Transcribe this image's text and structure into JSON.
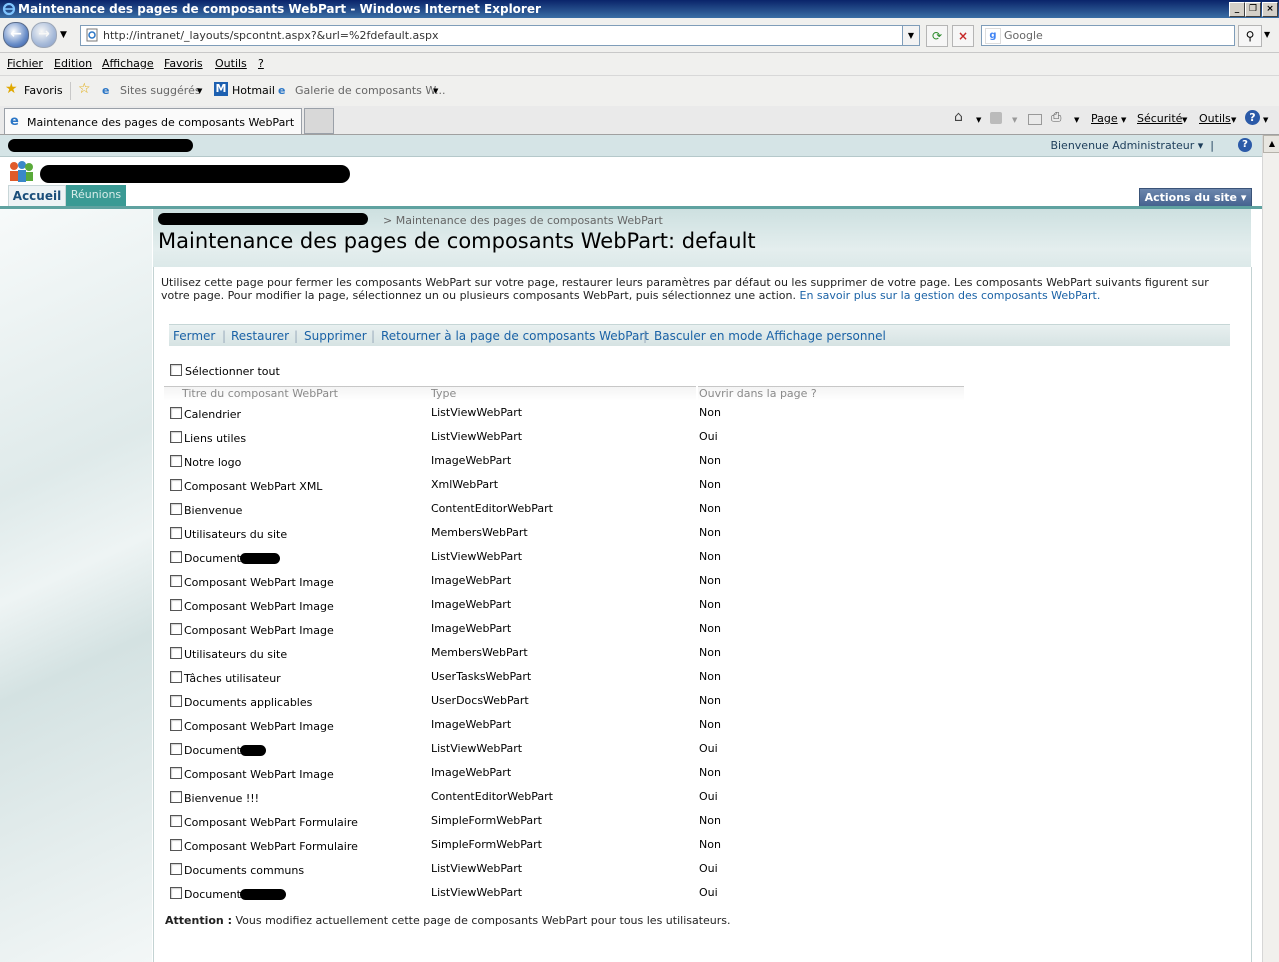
{
  "window": {
    "title": "Maintenance des pages de composants WebPart - Windows Internet Explorer"
  },
  "address": {
    "url": "http://intranet/_layouts/spcontnt.aspx?&url=%2fdefault.aspx",
    "search_placeholder": "Google"
  },
  "menu": [
    "Fichier",
    "Edition",
    "Affichage",
    "Favoris",
    "Outils",
    "?"
  ],
  "favorites": {
    "label": "Favoris",
    "items": [
      "Sites suggérés",
      "Hotmail",
      "Galerie de composants W..."
    ]
  },
  "tab": {
    "title": "Maintenance des pages de composants WebPart"
  },
  "commandbar": {
    "page": "Page",
    "security": "Sécurité",
    "tools": "Outils"
  },
  "sp": {
    "welcome": "Bienvenue Administrateur",
    "nav": {
      "home": "Accueil",
      "meetings": "Réunions"
    },
    "site_actions": "Actions du site",
    "breadcrumb_tail": "> Maintenance des pages de composants WebPart",
    "page_title": "Maintenance des pages de composants WebPart: default",
    "description": "Utilisez cette page pour fermer les composants WebPart sur votre page, restaurer leurs paramètres par défaut ou les supprimer de votre page. Les composants WebPart suivants figurent sur votre page. Pour modifier la page, sélectionnez un ou plusieurs composants WebPart, puis sélectionnez une action.",
    "description_link": "En savoir plus sur la gestion des composants WebPart.",
    "toolbar": [
      "Fermer",
      "Restaurer",
      "Supprimer",
      "Retourner à la page de composants WebPart",
      "Basculer en mode Affichage personnel"
    ],
    "select_all": "Sélectionner tout",
    "columns": [
      "Titre du composant WebPart",
      "Type",
      "Ouvrir dans la page ?"
    ],
    "rows": [
      {
        "title": "Calendrier",
        "type": "ListViewWebPart",
        "open": "Non"
      },
      {
        "title": "Liens utiles",
        "type": "ListViewWebPart",
        "open": "Oui"
      },
      {
        "title": "Notre logo",
        "type": "ImageWebPart",
        "open": "Non"
      },
      {
        "title": "Composant WebPart XML",
        "type": "XmlWebPart",
        "open": "Non"
      },
      {
        "title": "Bienvenue",
        "type": "ContentEditorWebPart",
        "open": "Non"
      },
      {
        "title": "Utilisateurs du site",
        "type": "MembersWebPart",
        "open": "Non"
      },
      {
        "title": "Documents",
        "type": "ListViewWebPart",
        "open": "Non"
      },
      {
        "title": "Composant WebPart Image",
        "type": "ImageWebPart",
        "open": "Non"
      },
      {
        "title": "Composant WebPart Image",
        "type": "ImageWebPart",
        "open": "Non"
      },
      {
        "title": "Composant WebPart Image",
        "type": "ImageWebPart",
        "open": "Non"
      },
      {
        "title": "Utilisateurs du site",
        "type": "MembersWebPart",
        "open": "Non"
      },
      {
        "title": "Tâches utilisateur",
        "type": "UserTasksWebPart",
        "open": "Non"
      },
      {
        "title": "Documents applicables",
        "type": "UserDocsWebPart",
        "open": "Non"
      },
      {
        "title": "Composant WebPart Image",
        "type": "ImageWebPart",
        "open": "Non"
      },
      {
        "title": "Documents",
        "type": "ListViewWebPart",
        "open": "Oui"
      },
      {
        "title": "Composant WebPart Image",
        "type": "ImageWebPart",
        "open": "Non"
      },
      {
        "title": "Bienvenue !!!",
        "type": "ContentEditorWebPart",
        "open": "Oui"
      },
      {
        "title": "Composant WebPart Formulaire",
        "type": "SimpleFormWebPart",
        "open": "Non"
      },
      {
        "title": "Composant WebPart Formulaire",
        "type": "SimpleFormWebPart",
        "open": "Non"
      },
      {
        "title": "Documents communs",
        "type": "ListViewWebPart",
        "open": "Oui"
      },
      {
        "title": "Documents",
        "type": "ListViewWebPart",
        "open": "Oui"
      }
    ],
    "warning_label": "Attention :",
    "warning_text": "Vous modifiez actuellement cette page de composants WebPart pour tous les utilisateurs."
  }
}
